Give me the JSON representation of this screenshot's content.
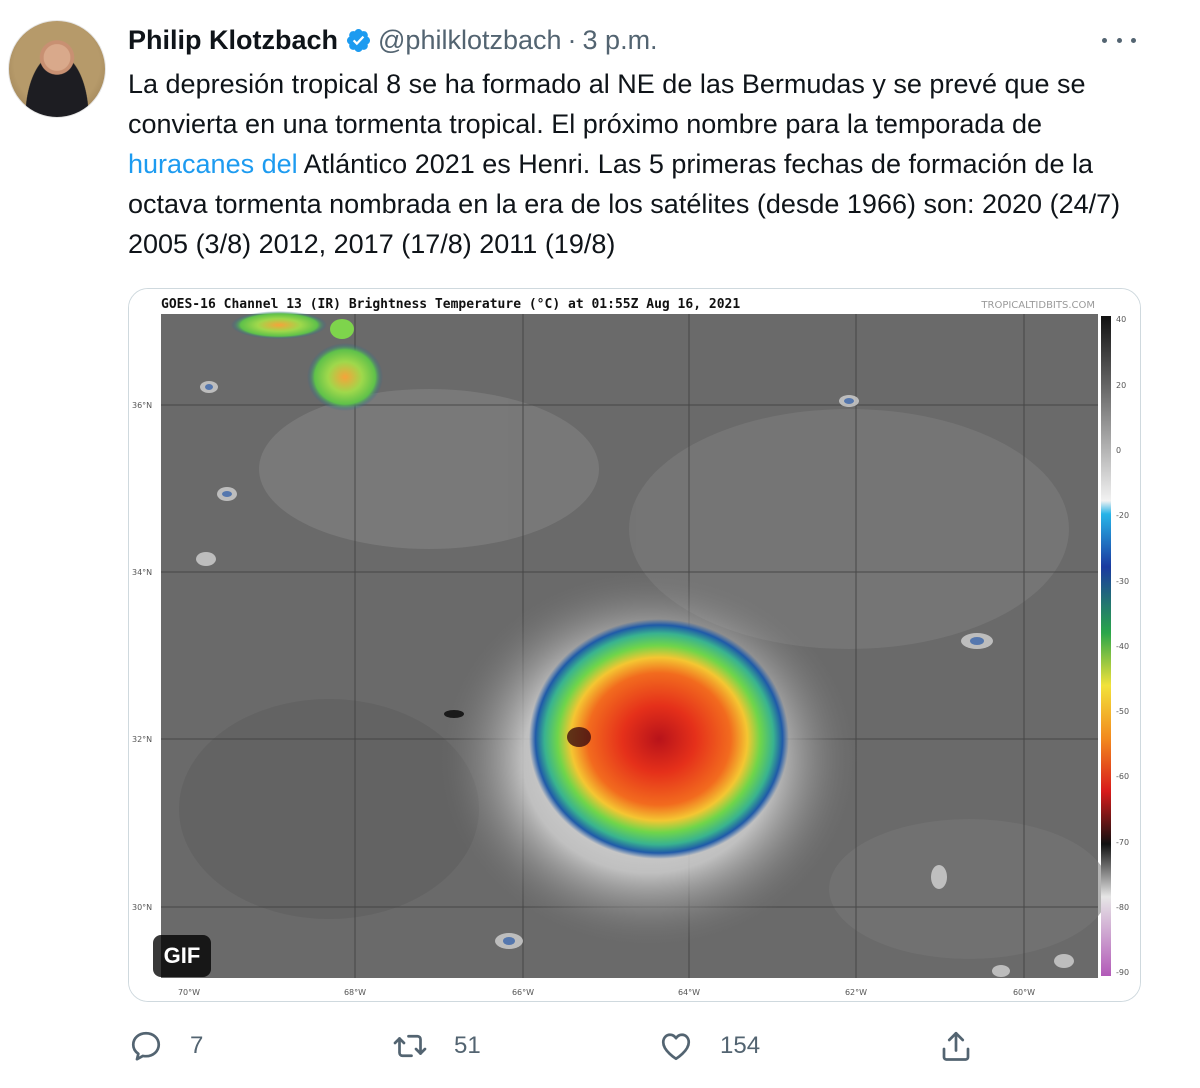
{
  "tweet": {
    "author_name": "Philip Klotzbach",
    "handle": "@philklotzbach",
    "separator": "·",
    "time": "3 p.m.",
    "text_before": "La depresión tropical 8 se ha formado al NE de las Bermudas y se prevé que se convierta en una tormenta tropical. El próximo nombre para la temporada de ",
    "link_text": "huracanes del",
    "text_after": " Atlántico 2021 es Henri. Las 5 primeras fechas de formación de la octava tormenta nombrada en la era de los satélites (desde 1966) son: 2020 (24/7) 2005 (3/8) 2012, 2017 (17/8) 2011 (19/8)"
  },
  "media": {
    "title": "GOES-16 Channel 13 (IR) Brightness Temperature (°C) at 01:55Z Aug 16, 2021",
    "credit": "TROPICALTIDBITS.COM",
    "badge": "GIF",
    "lat_labels": [
      "36°N",
      "34°N",
      "32°N",
      "30°N"
    ],
    "lon_labels": [
      "70°W",
      "68°W",
      "66°W",
      "64°W",
      "62°W",
      "60°W"
    ],
    "scale_labels": [
      "40",
      "20",
      "0",
      "-20",
      "-30",
      "-40",
      "-50",
      "-60",
      "-70",
      "-80",
      "-90"
    ]
  },
  "actions": {
    "reply_count": "7",
    "retweet_count": "51",
    "like_count": "154"
  },
  "icons": [
    "verified-icon",
    "more-icon",
    "reply-icon",
    "retweet-icon",
    "like-icon",
    "share-icon"
  ],
  "colors": {
    "link": "#1d9bf0",
    "verified": "#1d9bf0",
    "muted": "#536471"
  }
}
